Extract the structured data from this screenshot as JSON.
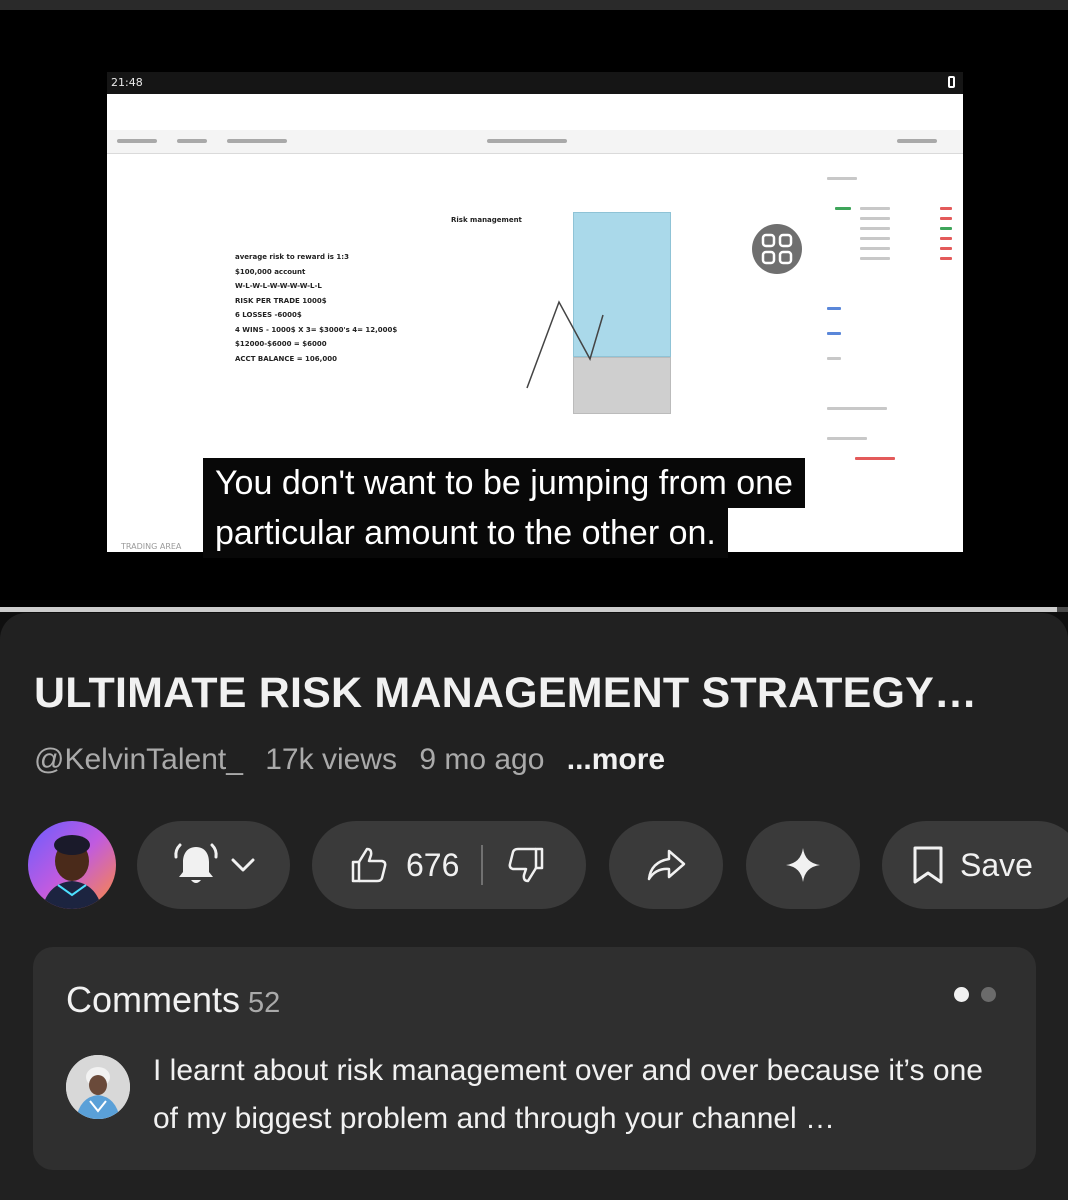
{
  "video": {
    "status_time": "21:48",
    "notes_title": "Risk management",
    "notes": [
      "average risk to reward is 1:3",
      "$100,000 account",
      "W-L-W-L-W-W-W-W-L-L",
      "RISK PER TRADE 1000$",
      "6 LOSSES -6000$",
      "4 WINS - 1000$ X 3= $3000's 4= 12,000$",
      "$12000-$6000 = $6000",
      "ACCT BALANCE = 106,000"
    ],
    "bottom_label": "TRADING AREA",
    "caption_line1": "You don't want to be jumping from one",
    "caption_line2": "particular amount to the other on.",
    "progress": 0.99
  },
  "details": {
    "title": "ULTIMATE RISK MANAGEMENT STRATEGY…",
    "channel": "@KelvinTalent_",
    "views": "17k views",
    "age": "9 mo ago",
    "more": "...more"
  },
  "actions": {
    "like_count": "676",
    "save_label": "Save"
  },
  "comments": {
    "heading": "Comments",
    "count": "52",
    "top_comment": "I learnt about risk management over and over because it’s one of my biggest problem and through your channel …"
  },
  "icons": {
    "bell": "bell-icon",
    "chevron": "chevron-down-icon",
    "like": "thumbs-up-icon",
    "dislike": "thumbs-down-icon",
    "share": "share-icon",
    "ask": "sparkle-icon",
    "save": "bookmark-icon"
  }
}
